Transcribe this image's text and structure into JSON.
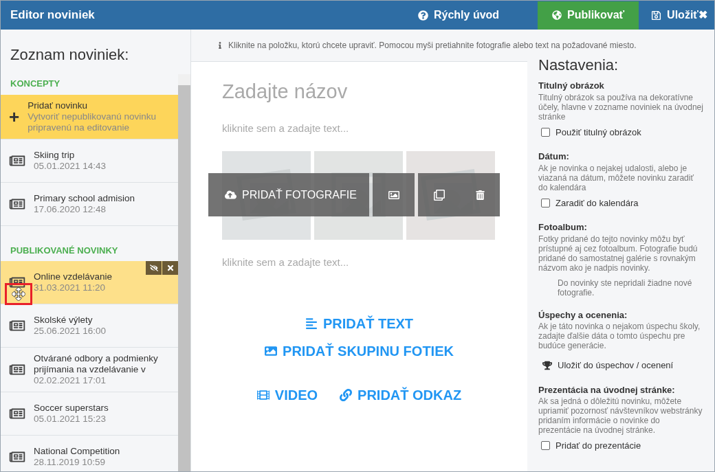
{
  "header": {
    "title": "Editor noviniek",
    "quick_intro": "Rýchly úvod",
    "publish": "Publikovať",
    "save": "Uložiť",
    "close": "✖"
  },
  "sidebar": {
    "title": "Zoznam noviniek:",
    "sections": [
      {
        "title": "KONCEPTY",
        "items": [
          {
            "kind": "add",
            "icon": "+",
            "title": "Pridať novinku",
            "subtitle": "Vytvoriť nepublikovanú novinku pripravenú na editovanie",
            "selected": false
          },
          {
            "kind": "news",
            "title": "Skiing trip",
            "subtitle": "05.01.2021 14:43",
            "selected": false
          },
          {
            "kind": "news",
            "title": "Primary school admision",
            "subtitle": "17.06.2020 12:48",
            "selected": false
          }
        ]
      },
      {
        "title": "PUBLIKOVANÉ NOVINKY",
        "items": [
          {
            "kind": "news",
            "title": "Online vzdelávanie",
            "subtitle": "31.03.2021 11:20",
            "selected": true
          },
          {
            "kind": "news",
            "title": "Skolské výlety",
            "subtitle": "25.06.2021 16:00",
            "selected": false
          },
          {
            "kind": "news",
            "title": "Otvárané odbory a podmienky prijímania na vzdelávanie v",
            "subtitle": "02.02.2021 17:01",
            "selected": false
          },
          {
            "kind": "news",
            "title": "Soccer superstars",
            "subtitle": "05.01.2021 15:23",
            "selected": false
          },
          {
            "kind": "news",
            "title": "National Competition",
            "subtitle": "28.11.2019 10:59",
            "selected": false
          }
        ]
      }
    ]
  },
  "editor": {
    "hint": "Kliknite na položku, ktorú chcete upraviť. Pomocou myši pretiahnite fotografie alebo text na požadované miesto.",
    "title_placeholder": "Zadajte názov",
    "text_placeholder_1": "kliknite sem a zadajte text...",
    "photo_toolbar": {
      "add_photos": "PRIDAŤ FOTOGRAFIE"
    },
    "text_placeholder_2": "kliknite sem a zadajte text...",
    "add_actions": [
      {
        "kind": "text",
        "label": "PRIDAŤ TEXT"
      },
      {
        "kind": "gallery",
        "label": "PRIDAŤ SKUPINU FOTIEK"
      },
      {
        "kind": "video",
        "label": "VIDEO"
      },
      {
        "kind": "link",
        "label": "PRIDAŤ ODKAZ"
      }
    ]
  },
  "settings": {
    "title": "Nastavenia:",
    "sections": [
      {
        "kind": "checkbox",
        "title": "Titulný obrázok",
        "description": "Titulný obrázok sa používa na dekoratívne účely, hlavne v zozname noviniek na úvodnej stránke",
        "label": "Použiť titulný obrázok",
        "checked": false
      },
      {
        "kind": "checkbox",
        "title": "Dátum:",
        "description": "Ak je novinka o nejakej udalosti, alebo je viazaná na dátum, môžete novinku zaradiť do kalendára",
        "label": "Zaradiť do kalendára",
        "checked": false
      },
      {
        "kind": "note",
        "title": "Fotoalbum:",
        "description": "Fotky pridané do tejto novinky môžu byť prístupné aj cez fotoalbum. Fotografie budú pridané do samostatnej galérie s rovnakým názvom ako je nadpis novinky.",
        "label": "Do novinky ste nepridali žiadne nové fotografie."
      },
      {
        "kind": "action",
        "title": "Úspechy a ocenenia:",
        "description": "Ak je táto novinka o nejakom úspechu školy, zadajte ďalšie dáta o tomto úspechu pre budúce generácie.",
        "label": "Uložiť do úspechov / ocenení"
      },
      {
        "kind": "checkbox",
        "title": "Prezentácia na úvodnej stránke:",
        "description": "Ak sa jedná o dôležitú novinku, môžete upriamiť pozornosť návštevníkov webstránky pridaním informácie o novinke do prezentácie na úvodnej stránke.",
        "label": "Pridať do prezentácie",
        "checked": false
      }
    ]
  }
}
